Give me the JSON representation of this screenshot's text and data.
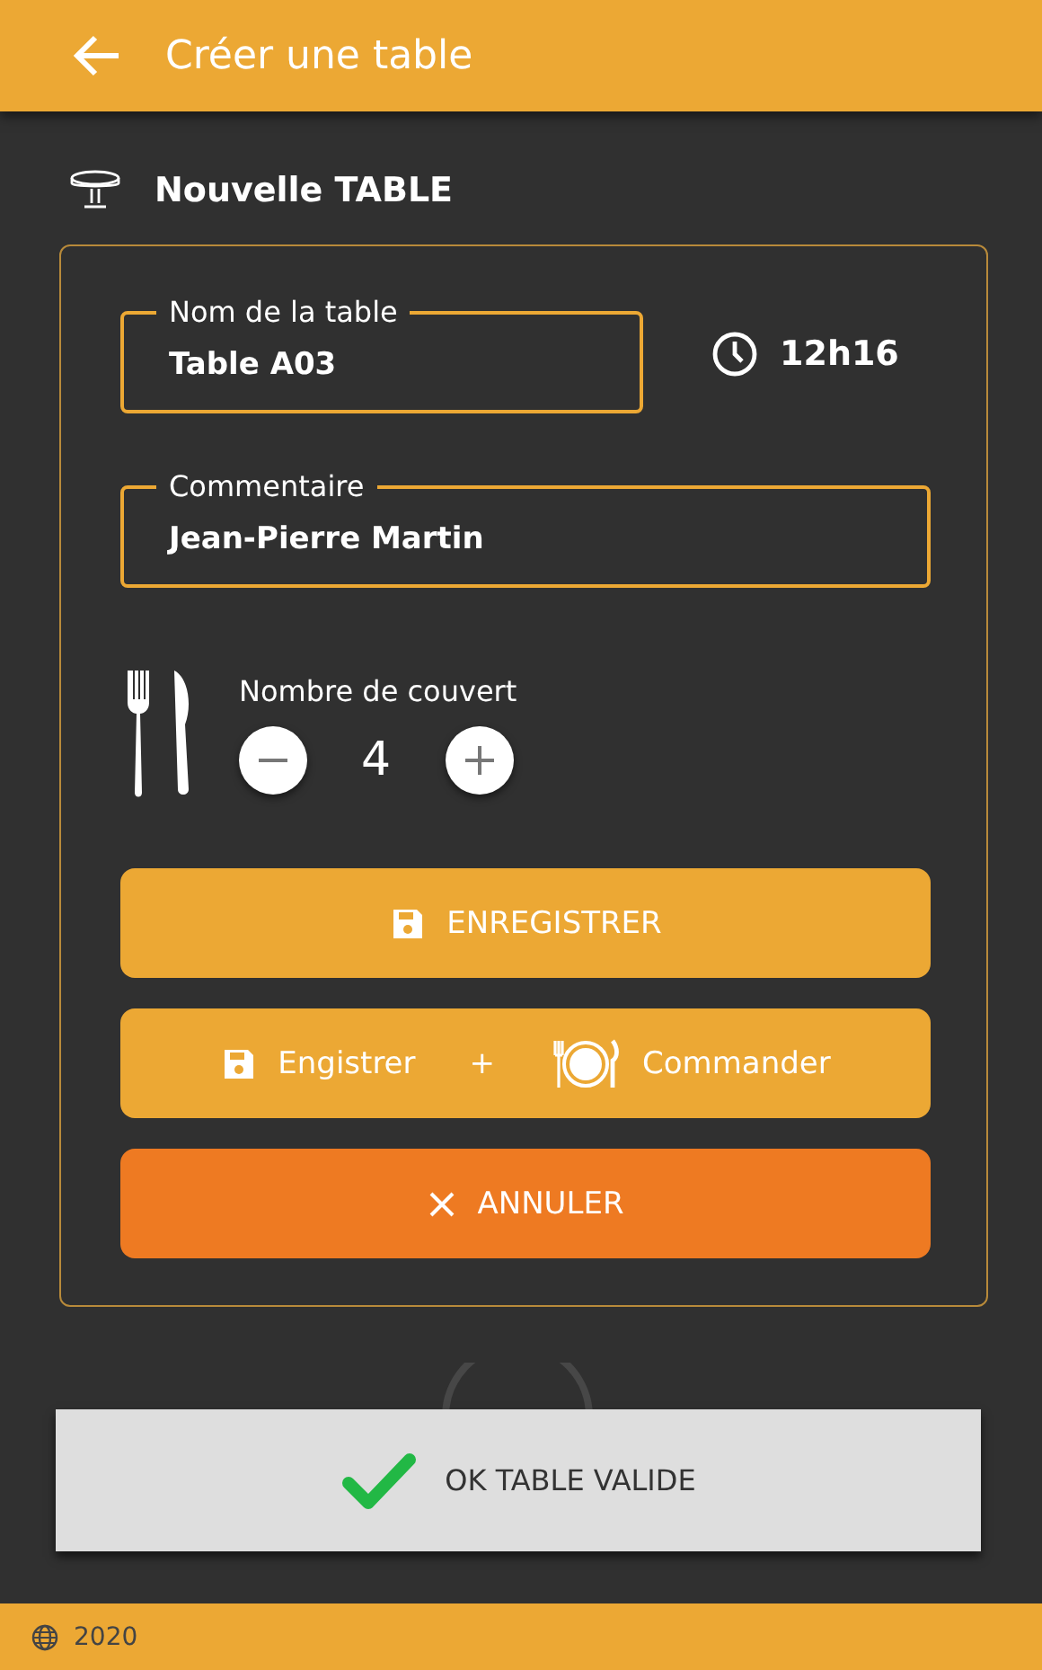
{
  "header": {
    "title": "Créer une table"
  },
  "section": {
    "title": "Nouvelle TABLE"
  },
  "fields": [
    {
      "label": "Nom de la table",
      "value": "Table A03"
    },
    {
      "label": "Commentaire",
      "value": "Jean-Pierre Martin"
    }
  ],
  "time": "12h16",
  "covers": {
    "label": "Nombre de couvert",
    "value": "4"
  },
  "buttons": [
    {
      "kind": "save",
      "label": "ENREGISTRER"
    },
    {
      "kind": "save-order",
      "label": "Engistrer",
      "joiner": "+",
      "label_2": "Commander"
    },
    {
      "kind": "cancel",
      "label": "ANNULER"
    }
  ],
  "toast": {
    "text": "OK TABLE VALIDE"
  },
  "footer": {
    "year": "2020"
  }
}
